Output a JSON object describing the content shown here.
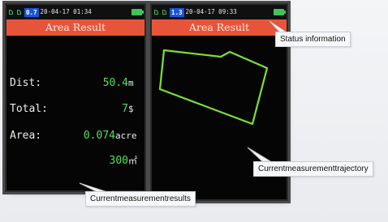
{
  "left_screen": {
    "status_bar": {
      "hdop": "0.7",
      "datetime": "20-04-17 01:34"
    },
    "title": "Area Result",
    "rows": {
      "dist": {
        "label": "Dist:",
        "value": "50.4",
        "unit": "m"
      },
      "total": {
        "label": "Total:",
        "value": "7",
        "unit": "$"
      },
      "area": {
        "label": "Area:",
        "value": "0.074",
        "unit": "acre"
      },
      "area_sqm": {
        "value": "300",
        "unit": "㎡"
      }
    }
  },
  "right_screen": {
    "status_bar": {
      "hdop": "1.3",
      "datetime": "20-04-17 09:33"
    },
    "title": "Area Result",
    "trajectory_color": "#7be22f"
  },
  "callouts": {
    "status": "Status information",
    "trajectory": "Currentmeasurementtrajectory",
    "results": "Currentmeasurementresults"
  },
  "colors": {
    "title_bar": "#e8543a",
    "value_text": "#4fe05a",
    "screen_bg": "#050505",
    "hdop_badge": "#1b55d6"
  }
}
